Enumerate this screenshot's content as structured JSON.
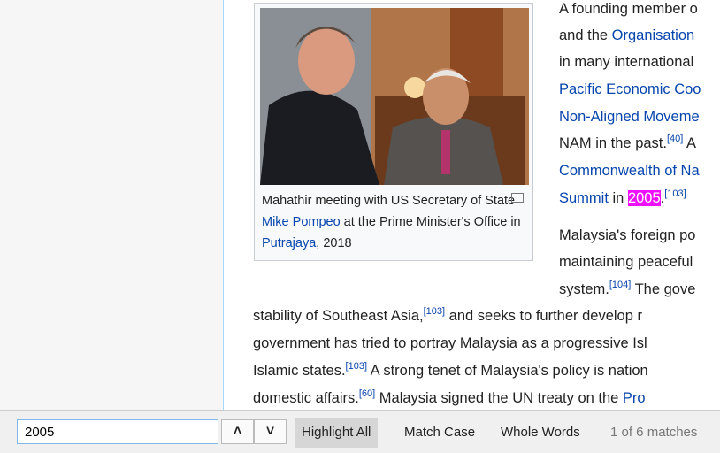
{
  "article": {
    "right_lines": [
      [
        "A founding member o"
      ],
      [
        "and the ",
        "Organisation"
      ],
      [
        "in many international"
      ],
      [
        "",
        "Pacific Economic Coo"
      ],
      [
        "",
        "Non-Aligned Moveme"
      ],
      [
        "NAM in the past.",
        "",
        "[40]",
        " A"
      ],
      [
        "",
        "Commonwealth of Na"
      ],
      [
        "",
        "Summit",
        " in ",
        "2005",
        ".",
        "[103]"
      ]
    ],
    "p2_lines": [
      "Malaysia's foreign po",
      "maintaining peaceful",
      "system."
    ],
    "p2_ref": "[104]",
    "p2_tail": " The gove",
    "full_lines": [
      {
        "a": "stability of Southeast Asia,",
        "ref": "[103]",
        "b": " and seeks to further develop r"
      },
      {
        "a": "government has tried to portray Malaysia as a progressive Isl",
        "ref": "",
        "b": ""
      },
      {
        "a": "Islamic states.",
        "ref": "[103]",
        "b": " A strong tenet of Malaysia's policy is nation"
      },
      {
        "a": "domestic affairs.",
        "ref": "[60]",
        "b": " Malaysia signed the UN treaty on the ",
        "link": "Pro"
      }
    ],
    "caption": {
      "t1": "Mahathir meeting with US Secretary of State ",
      "l1": "Mike Pompeo",
      "t2": " at the Prime Minister's Office in ",
      "l2": "Putrajaya",
      "t3": ", 2018"
    }
  },
  "findbar": {
    "query": "2005",
    "highlight_all": "Highlight All",
    "match_case": "Match Case",
    "whole_words": "Whole Words",
    "status": "1 of 6 matches",
    "up_icon": "chevron-up-icon",
    "down_icon": "chevron-down-icon"
  },
  "colors": {
    "highlight": "#ef0fff",
    "link": "#0645ad"
  }
}
